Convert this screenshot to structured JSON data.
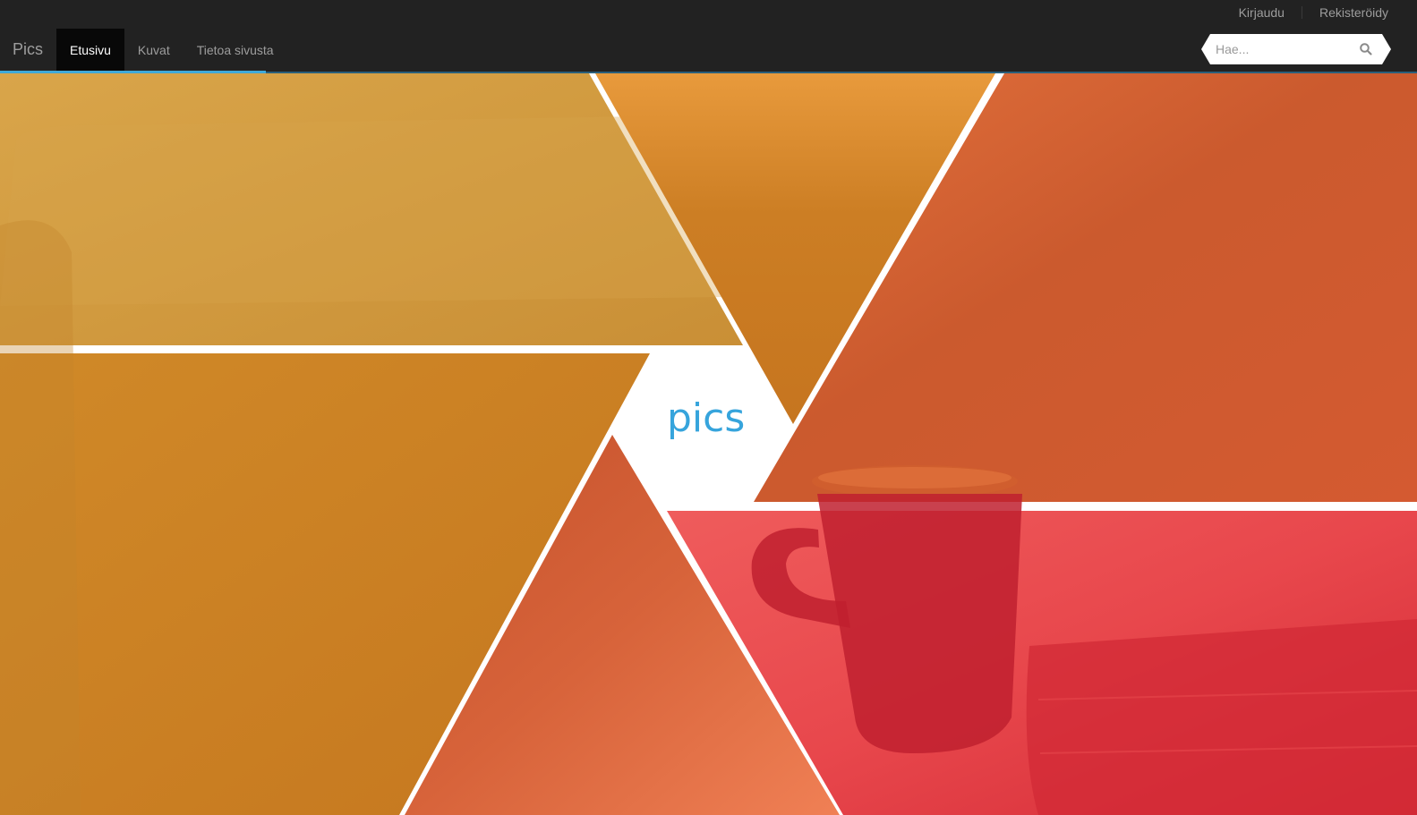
{
  "header": {
    "brand": "Pics",
    "tabs": [
      {
        "label": "Etusivu",
        "active": true
      },
      {
        "label": "Kuvat",
        "active": false
      },
      {
        "label": "Tietoa sivusta",
        "active": false
      }
    ],
    "top_links": {
      "login": "Kirjaudu",
      "register": "Rekisteröidy"
    },
    "search": {
      "placeholder": "Hae...",
      "icon": "search-icon"
    }
  },
  "hero": {
    "logo": "pics",
    "colors": {
      "accent": "#36a4dc",
      "gold": "#cf9a3d",
      "amber": "#c97b22",
      "orange": "#cc5a2b",
      "salmon": "#f07e55",
      "red": "#d0283a"
    }
  }
}
